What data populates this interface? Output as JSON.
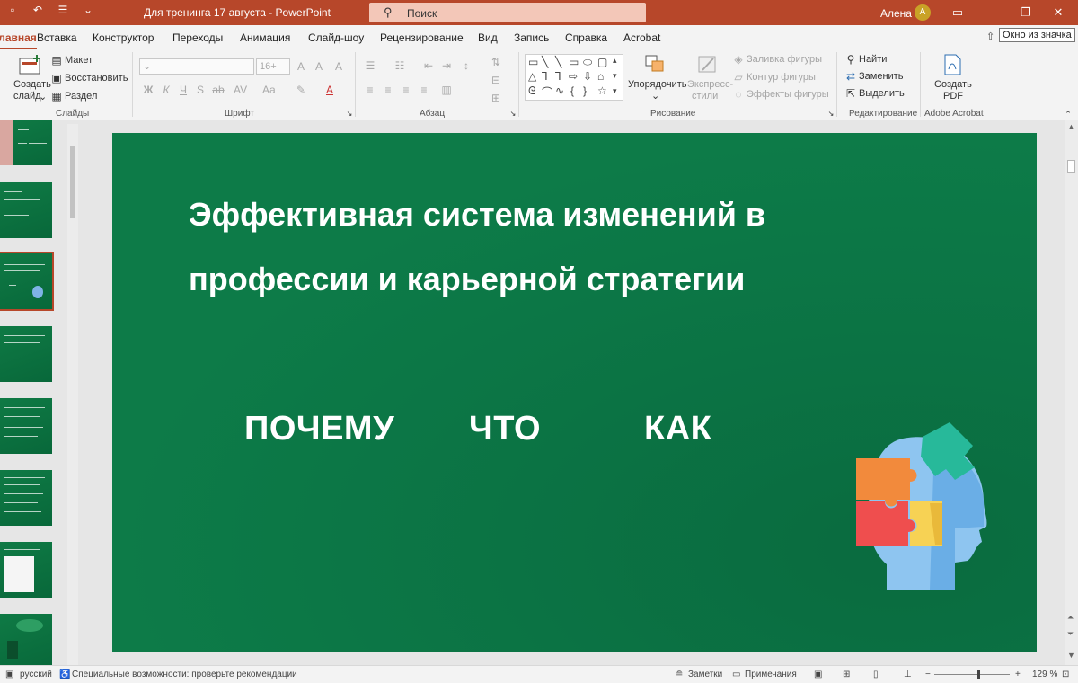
{
  "window": {
    "title": "Для тренинга 17 августа  -  PowerPoint",
    "search_placeholder": "Поиск",
    "user": "Алена",
    "user_initial": "А"
  },
  "tabs": [
    "Главная",
    "Вставка",
    "Конструктор",
    "Переходы",
    "Анимация",
    "Слайд-шоу",
    "Рецензирование",
    "Вид",
    "Запись",
    "Справка",
    "Acrobat"
  ],
  "tooltip": "Окно из значка",
  "ribbon": {
    "slides_group": {
      "label": "Слайды",
      "new_slide_line1": "Создать",
      "new_slide_line2": "слайд",
      "layout": "Макет",
      "reset": "Восстановить",
      "section": "Раздел"
    },
    "font_group": {
      "label": "Шрифт",
      "font_size": "16+"
    },
    "paragraph_group": {
      "label": "Абзац"
    },
    "drawing_group": {
      "label": "Рисование",
      "arrange": "Упорядочить",
      "quick_styles_line1": "Экспресс-",
      "quick_styles_line2": "стили",
      "shape_fill": "Заливка фигуры",
      "shape_outline": "Контур фигуры",
      "shape_effects": "Эффекты фигуры"
    },
    "editing_group": {
      "label": "Редактирование",
      "find": "Найти",
      "replace": "Заменить",
      "select": "Выделить"
    },
    "acrobat_group": {
      "label": "Adobe Acrobat",
      "create_pdf_line1": "Создать",
      "create_pdf_line2": "PDF"
    }
  },
  "slide": {
    "title_line1": "Эффективная система изменений в",
    "title_line2": "профессии и карьерной стратегии",
    "words": [
      "ПОЧЕМУ",
      "ЧТО",
      "КАК"
    ]
  },
  "statusbar": {
    "language": "русский",
    "accessibility": "Специальные возможности: проверьте рекомендации",
    "notes": "Заметки",
    "comments": "Примечания",
    "zoom": "129 %"
  },
  "colors": {
    "accent": "#b7472a",
    "slide_green": "#0b7344"
  }
}
